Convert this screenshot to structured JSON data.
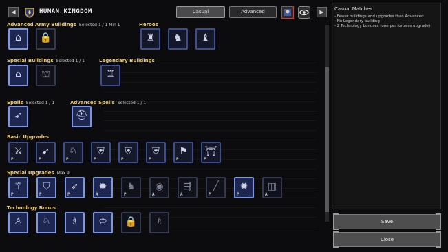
{
  "header": {
    "title": "HUMAN KINGDOM",
    "prev_arrow": "◀",
    "next_arrow": "▶",
    "modes": [
      {
        "label": "Casual",
        "active": true
      },
      {
        "label": "Advanced",
        "active": false
      }
    ],
    "icons": [
      "faction-portrait-icon",
      "eye-icon"
    ]
  },
  "sections": {
    "advanced_army": {
      "title": "Advanced Army Buildings",
      "sub": "Selected 1 / 1  Min 1"
    },
    "heroes": {
      "title": "Heroes",
      "sub": ""
    },
    "special_buildings": {
      "title": "Special Buildings",
      "sub": "Selected 1 / 1"
    },
    "legendary": {
      "title": "Legendary Buildings",
      "sub": ""
    },
    "spells": {
      "title": "Spells",
      "sub": "Selected 1 / 1"
    },
    "advanced_spells": {
      "title": "Advanced Spells",
      "sub": "Selected 1 / 1"
    },
    "basic_upgrades": {
      "title": "Basic Upgrades",
      "sub": ""
    },
    "special_upgrades": {
      "title": "Special Upgrades",
      "sub": "Max 9"
    },
    "technology": {
      "title": "Technology Bonus",
      "sub": ""
    }
  },
  "slots": {
    "advanced_army": [
      {
        "icon": "stable-building-icon",
        "glyph": "⌂",
        "tag": "",
        "selected": true
      },
      {
        "icon": "locked-building-icon",
        "glyph": "🔒",
        "tag": "",
        "selected": false
      }
    ],
    "heroes": [
      {
        "icon": "hero-banner-icon",
        "glyph": "♜",
        "tag": "",
        "selected": false
      },
      {
        "icon": "hero-knight-icon",
        "glyph": "♞",
        "tag": "",
        "selected": false
      },
      {
        "icon": "hero-mage-icon",
        "glyph": "♝",
        "tag": "",
        "selected": false
      }
    ],
    "special_buildings": [
      {
        "icon": "barracks-building-icon",
        "glyph": "⌂",
        "tag": "",
        "selected": true
      },
      {
        "icon": "temple-building-icon",
        "glyph": "⛫",
        "tag": "",
        "selected": false
      }
    ],
    "legendary": [
      {
        "icon": "castle-building-icon",
        "glyph": "♖",
        "tag": "",
        "selected": false
      }
    ],
    "spells": [
      {
        "icon": "arrow-volley-spell-icon",
        "glyph": "➶",
        "tag": "",
        "selected": true
      }
    ],
    "advanced_spells": [
      {
        "icon": "knight-helmet-spell-icon",
        "glyph": "⛑",
        "tag": "",
        "selected": true
      }
    ],
    "basic_upgrades": [
      {
        "icon": "sword-upgrade-icon",
        "glyph": "⚔",
        "tag": "P"
      },
      {
        "icon": "crossbow-upgrade-icon",
        "glyph": "➹",
        "tag": "P"
      },
      {
        "icon": "rider-upgrade-icon",
        "glyph": "♘",
        "tag": "P"
      },
      {
        "icon": "heavy-armor-upgrade-icon",
        "glyph": "⛨",
        "tag": "P"
      },
      {
        "icon": "plate-armor-upgrade-icon",
        "glyph": "⛨",
        "tag": "P"
      },
      {
        "icon": "mail-armor-upgrade-icon",
        "glyph": "⛨",
        "tag": "P"
      },
      {
        "icon": "banner-upgrade-icon",
        "glyph": "⚑",
        "tag": "P"
      },
      {
        "icon": "gate-upgrade-icon",
        "glyph": "⛩",
        "tag": "P"
      }
    ],
    "special_upgrades": [
      {
        "icon": "halberd-upgrade-icon",
        "glyph": "⚚",
        "tag": "P",
        "selected": true
      },
      {
        "icon": "shield-sword-upgrade-icon",
        "glyph": "⛉",
        "tag": "P",
        "selected": true
      },
      {
        "icon": "flame-arrow-upgrade-icon",
        "glyph": "➶",
        "tag": "P",
        "selected": true
      },
      {
        "icon": "sun-burst-upgrade-icon",
        "glyph": "✸",
        "tag": "A",
        "selected": true
      },
      {
        "icon": "horse-upgrade-icon",
        "glyph": "♞",
        "tag": "P",
        "selected": false
      },
      {
        "icon": "dark-orb-upgrade-icon",
        "glyph": "◉",
        "tag": "A",
        "selected": false
      },
      {
        "icon": "twin-bolt-upgrade-icon",
        "glyph": "⇶",
        "tag": "A",
        "selected": false
      },
      {
        "icon": "lance-upgrade-icon",
        "glyph": "╱",
        "tag": "P",
        "selected": false
      },
      {
        "icon": "explosion-upgrade-icon",
        "glyph": "✹",
        "tag": "P",
        "selected": true
      },
      {
        "icon": "portal-upgrade-icon",
        "glyph": "▥",
        "tag": "A",
        "selected": false
      }
    ],
    "technology": [
      {
        "icon": "soldier-tech-icon",
        "glyph": "♙",
        "tag": "",
        "selected": true
      },
      {
        "icon": "knight-tech-icon",
        "glyph": "♘",
        "tag": "",
        "selected": true
      },
      {
        "icon": "crossbowman-tech-icon",
        "glyph": "♗",
        "tag": "",
        "selected": true
      },
      {
        "icon": "priest-tech-icon",
        "glyph": "♔",
        "tag": "",
        "selected": true
      },
      {
        "icon": "locked-tech-icon",
        "glyph": "🔒",
        "tag": "",
        "selected": false
      },
      {
        "icon": "wizard-tech-icon",
        "glyph": "♗",
        "tag": "",
        "selected": false
      }
    ]
  },
  "panel": {
    "title": "Casual Matches",
    "lines": [
      "- Fewer buildings and upgrades than Advanced",
      "- No Legendary building",
      "- 2 Technology bonuses (one per fortress upgrade)"
    ]
  },
  "buttons": {
    "save": "Save",
    "close": "Close"
  },
  "colors": {
    "accent": "#e8c870",
    "slot_border": "#3c4f8c",
    "slot_selected": "#7c96e0"
  }
}
